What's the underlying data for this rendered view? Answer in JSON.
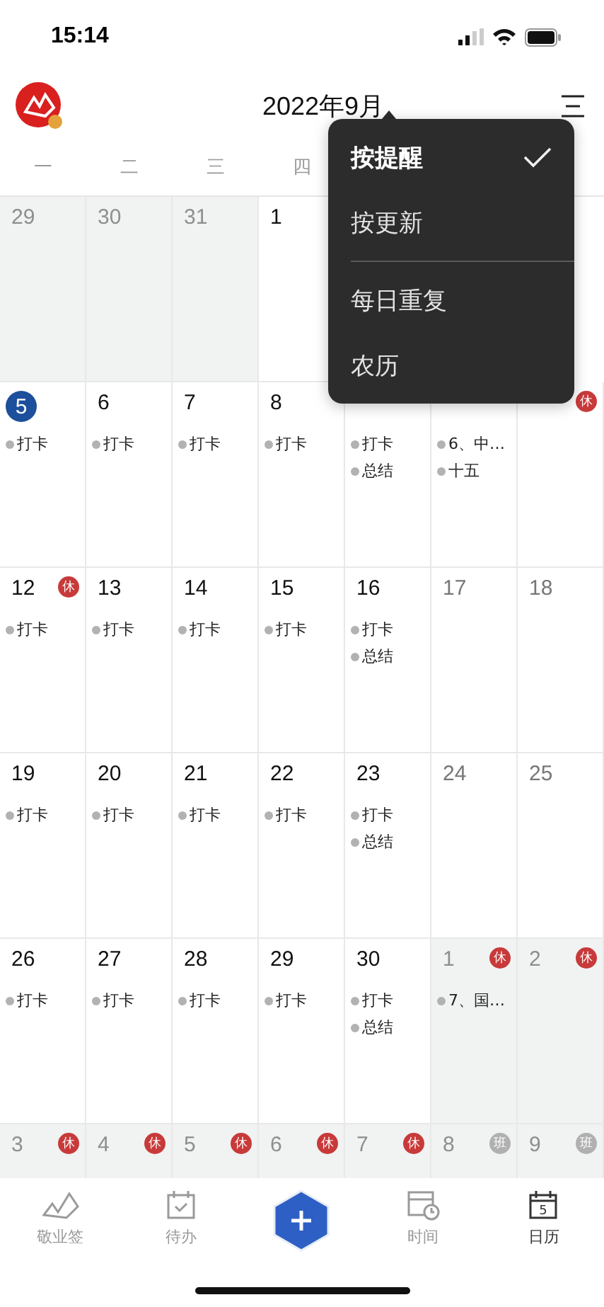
{
  "status_bar": {
    "time": "15:14"
  },
  "header": {
    "title": "2022年9月"
  },
  "weekdays": [
    "一",
    "二",
    "三",
    "四"
  ],
  "weeks": [
    [
      {
        "day": "29",
        "other_month": true
      },
      {
        "day": "30",
        "other_month": true
      },
      {
        "day": "31",
        "other_month": true
      },
      {
        "day": "1",
        "other_month": false
      }
    ],
    [
      {
        "day": "5",
        "other_month": false,
        "today": true,
        "events": [
          "打卡"
        ]
      },
      {
        "day": "6",
        "other_month": false,
        "events": [
          "打卡"
        ]
      },
      {
        "day": "7",
        "other_month": false,
        "events": [
          "打卡"
        ]
      },
      {
        "day": "8",
        "other_month": false,
        "events": [
          "打卡"
        ]
      },
      {
        "other_month": false,
        "events": [
          "打卡",
          "总结"
        ]
      },
      {
        "other_month": false,
        "events": [
          "6、中…",
          "十五"
        ]
      },
      {
        "other_month": false,
        "badge": {
          "kind": "rest",
          "label": "休"
        }
      }
    ],
    [
      {
        "day": "12",
        "other_month": false,
        "badge": {
          "kind": "rest",
          "label": "休"
        },
        "events": [
          "打卡"
        ]
      },
      {
        "day": "13",
        "other_month": false,
        "events": [
          "打卡"
        ]
      },
      {
        "day": "14",
        "other_month": false,
        "events": [
          "打卡"
        ]
      },
      {
        "day": "15",
        "other_month": false,
        "events": [
          "打卡"
        ]
      },
      {
        "day": "16",
        "other_month": false,
        "events": [
          "打卡",
          "总结"
        ]
      },
      {
        "day": "17",
        "other_month": false,
        "weekend": true
      },
      {
        "day": "18",
        "other_month": false,
        "weekend": true
      }
    ],
    [
      {
        "day": "19",
        "other_month": false,
        "events": [
          "打卡"
        ]
      },
      {
        "day": "20",
        "other_month": false,
        "events": [
          "打卡"
        ]
      },
      {
        "day": "21",
        "other_month": false,
        "events": [
          "打卡"
        ]
      },
      {
        "day": "22",
        "other_month": false,
        "events": [
          "打卡"
        ]
      },
      {
        "day": "23",
        "other_month": false,
        "events": [
          "打卡",
          "总结"
        ]
      },
      {
        "day": "24",
        "other_month": false,
        "weekend": true
      },
      {
        "day": "25",
        "other_month": false,
        "weekend": true
      }
    ],
    [
      {
        "day": "26",
        "other_month": false,
        "events": [
          "打卡"
        ]
      },
      {
        "day": "27",
        "other_month": false,
        "events": [
          "打卡"
        ]
      },
      {
        "day": "28",
        "other_month": false,
        "events": [
          "打卡"
        ]
      },
      {
        "day": "29",
        "other_month": false,
        "events": [
          "打卡"
        ]
      },
      {
        "day": "30",
        "other_month": false,
        "events": [
          "打卡",
          "总结"
        ]
      },
      {
        "day": "1",
        "other_month": true,
        "badge": {
          "kind": "rest",
          "label": "休"
        },
        "events": [
          "7、国…"
        ]
      },
      {
        "day": "2",
        "other_month": true,
        "badge": {
          "kind": "rest",
          "label": "休"
        }
      }
    ],
    [
      {
        "day": "3",
        "other_month": true,
        "badge": {
          "kind": "rest",
          "label": "休"
        }
      },
      {
        "day": "4",
        "other_month": true,
        "badge": {
          "kind": "rest",
          "label": "休"
        }
      },
      {
        "day": "5",
        "other_month": true,
        "badge": {
          "kind": "rest",
          "label": "休"
        }
      },
      {
        "day": "6",
        "other_month": true,
        "badge": {
          "kind": "rest",
          "label": "休"
        }
      },
      {
        "day": "7",
        "other_month": true,
        "badge": {
          "kind": "rest",
          "label": "休"
        }
      },
      {
        "day": "8",
        "other_month": true,
        "badge": {
          "kind": "work",
          "label": "班"
        }
      },
      {
        "day": "9",
        "other_month": true,
        "badge": {
          "kind": "work",
          "label": "班"
        }
      }
    ]
  ],
  "menu": {
    "items": [
      {
        "label": "按提醒",
        "selected": true,
        "divider_before": false
      },
      {
        "label": "按更新",
        "selected": false,
        "divider_before": false
      },
      {
        "label": "每日重复",
        "selected": false,
        "divider_before": true
      },
      {
        "label": "农历",
        "selected": false,
        "divider_before": false
      }
    ]
  },
  "tab_bar": {
    "items": [
      {
        "kind": "notes",
        "label": "敬业签",
        "selected": false
      },
      {
        "kind": "todo",
        "label": "待办",
        "selected": false
      },
      {
        "kind": "add"
      },
      {
        "kind": "time",
        "label": "时间",
        "selected": false
      },
      {
        "kind": "calendar",
        "label": "日历",
        "selected": true,
        "icon_text": "5"
      }
    ]
  }
}
